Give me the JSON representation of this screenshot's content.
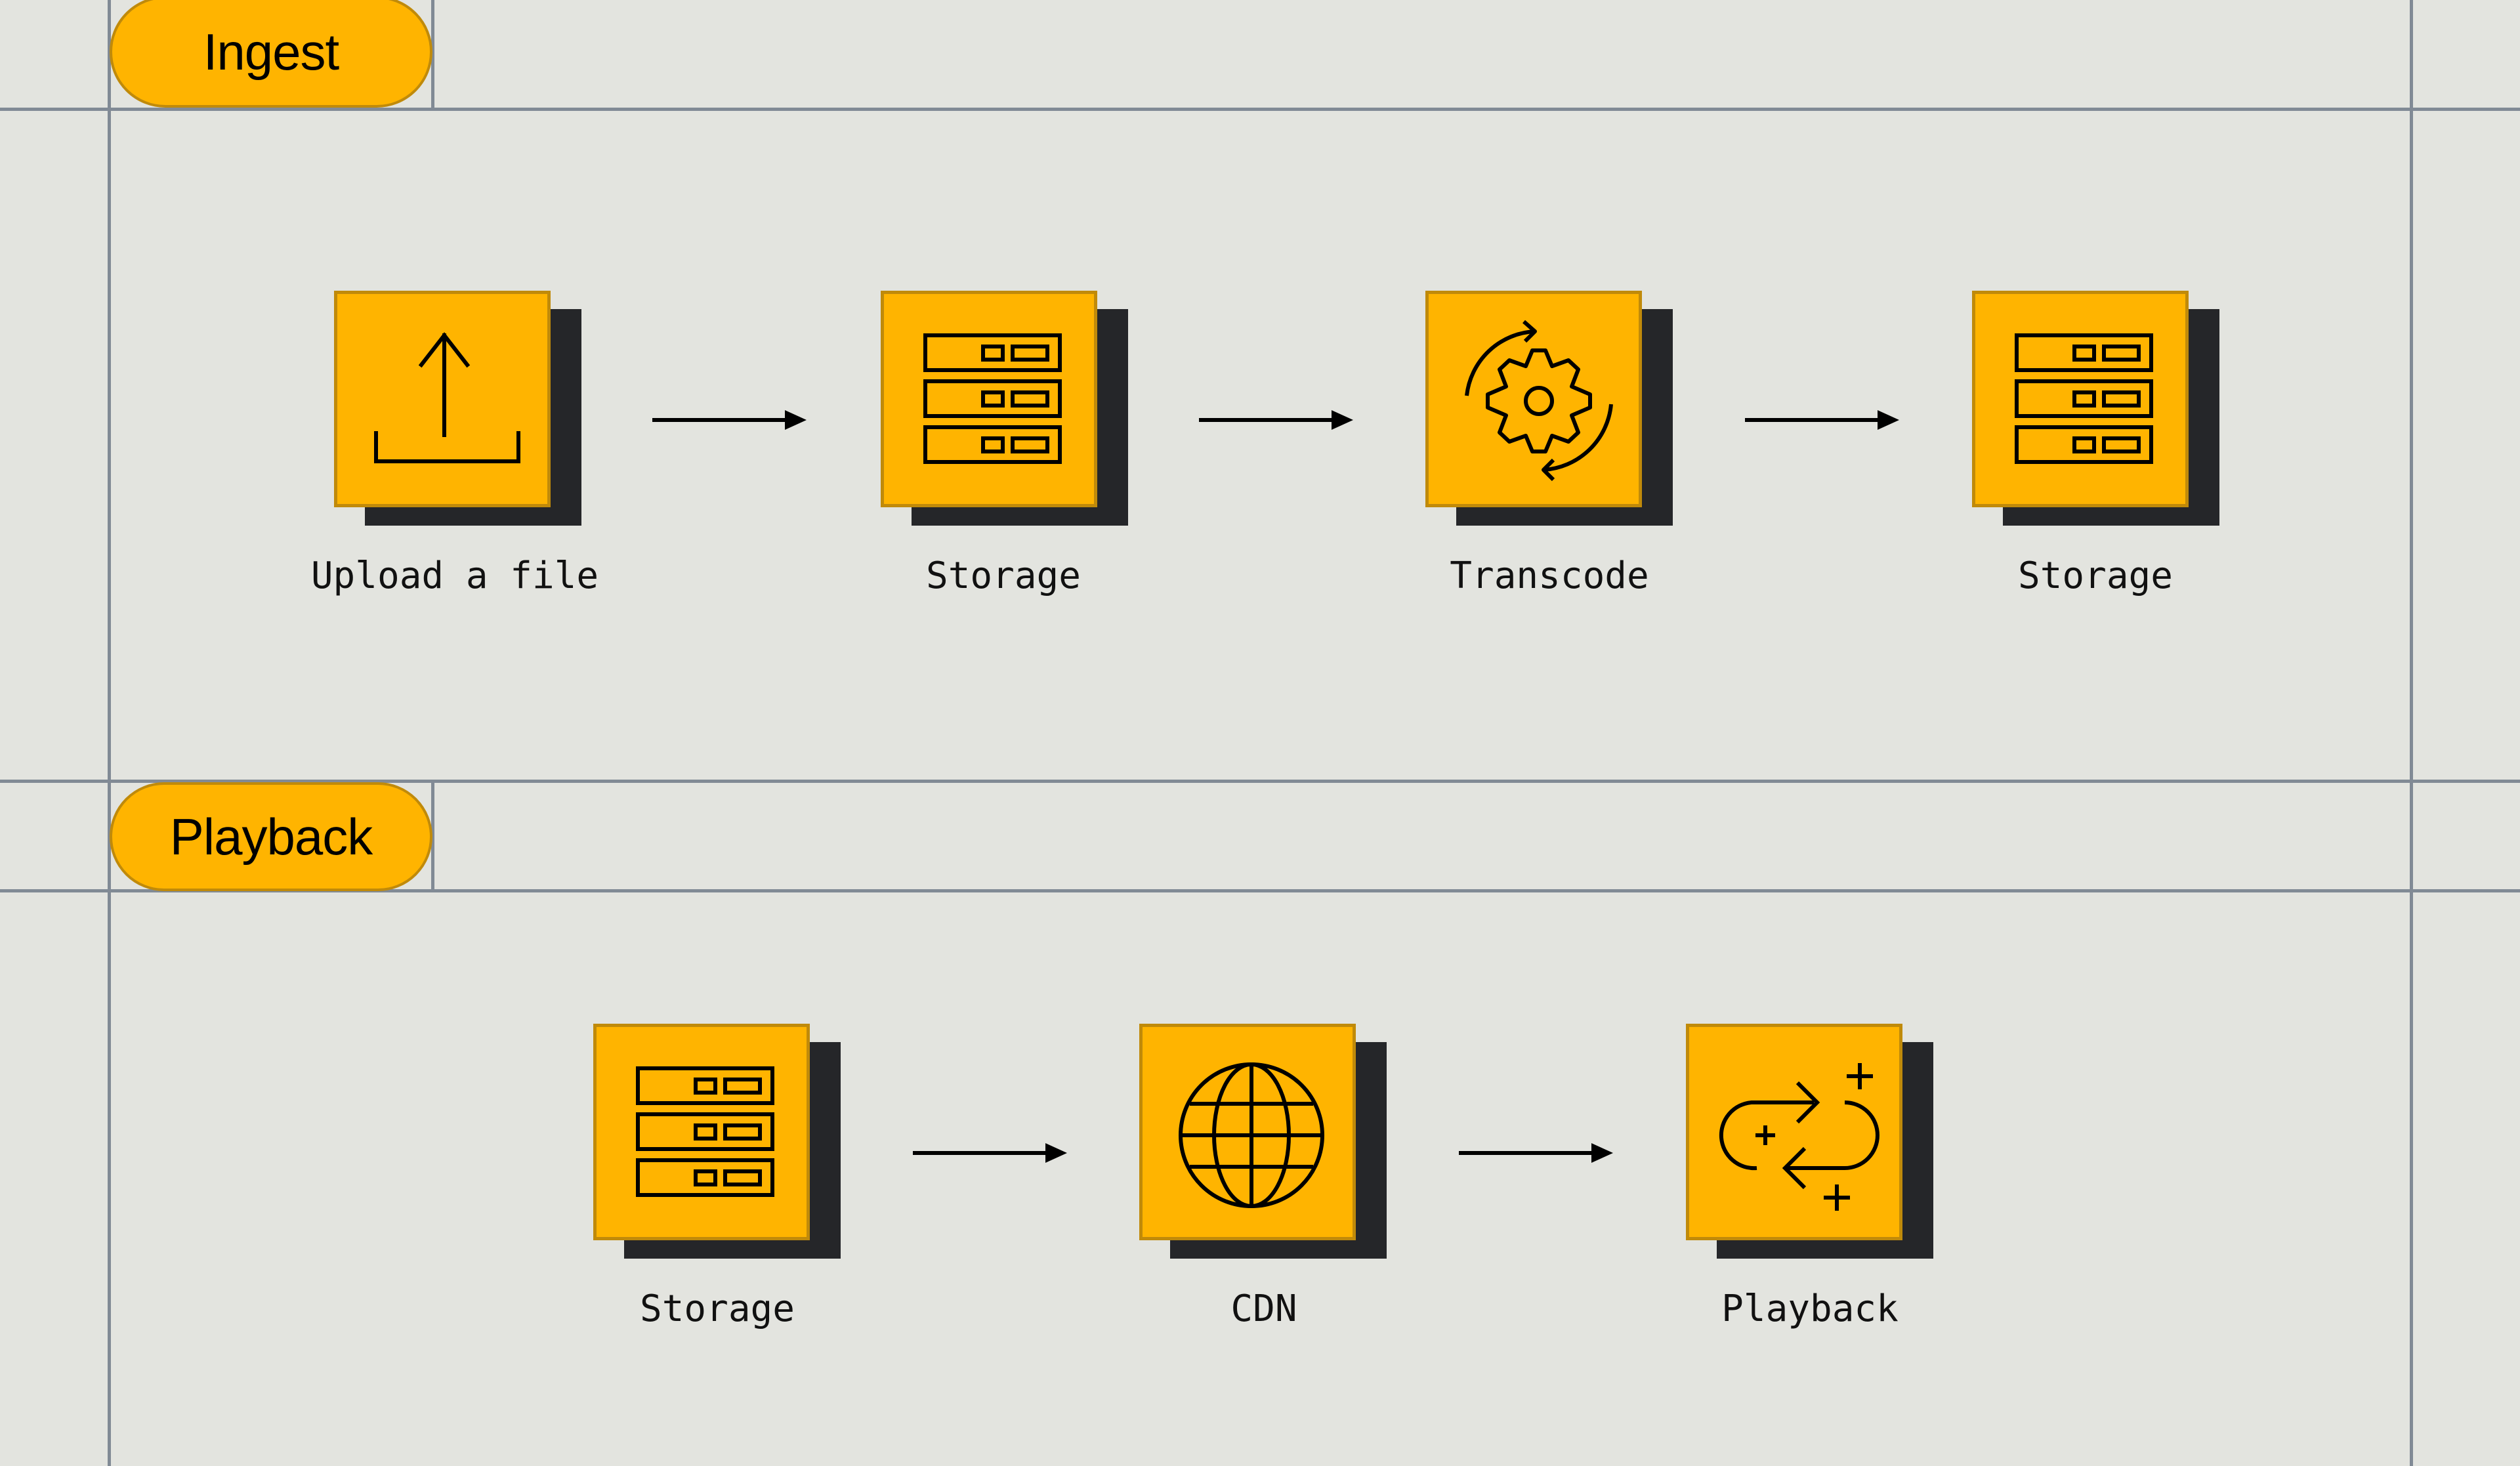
{
  "colors": {
    "background": "#e3e4df",
    "grid": "#818a95",
    "node_fill": "#ffb400",
    "node_border": "#c08a0a",
    "shadow": "#252629",
    "ink": "#000000"
  },
  "sections": [
    {
      "title": "Ingest",
      "nodes": [
        {
          "label": "Upload a file",
          "icon": "upload-icon"
        },
        {
          "label": "Storage",
          "icon": "server-icon"
        },
        {
          "label": "Transcode",
          "icon": "gear-cycle-icon"
        },
        {
          "label": "Storage",
          "icon": "server-icon"
        }
      ]
    },
    {
      "title": "Playback",
      "nodes": [
        {
          "label": "Storage",
          "icon": "server-icon"
        },
        {
          "label": "CDN",
          "icon": "globe-icon"
        },
        {
          "label": "Playback",
          "icon": "loop-sparkle-icon"
        }
      ]
    }
  ]
}
